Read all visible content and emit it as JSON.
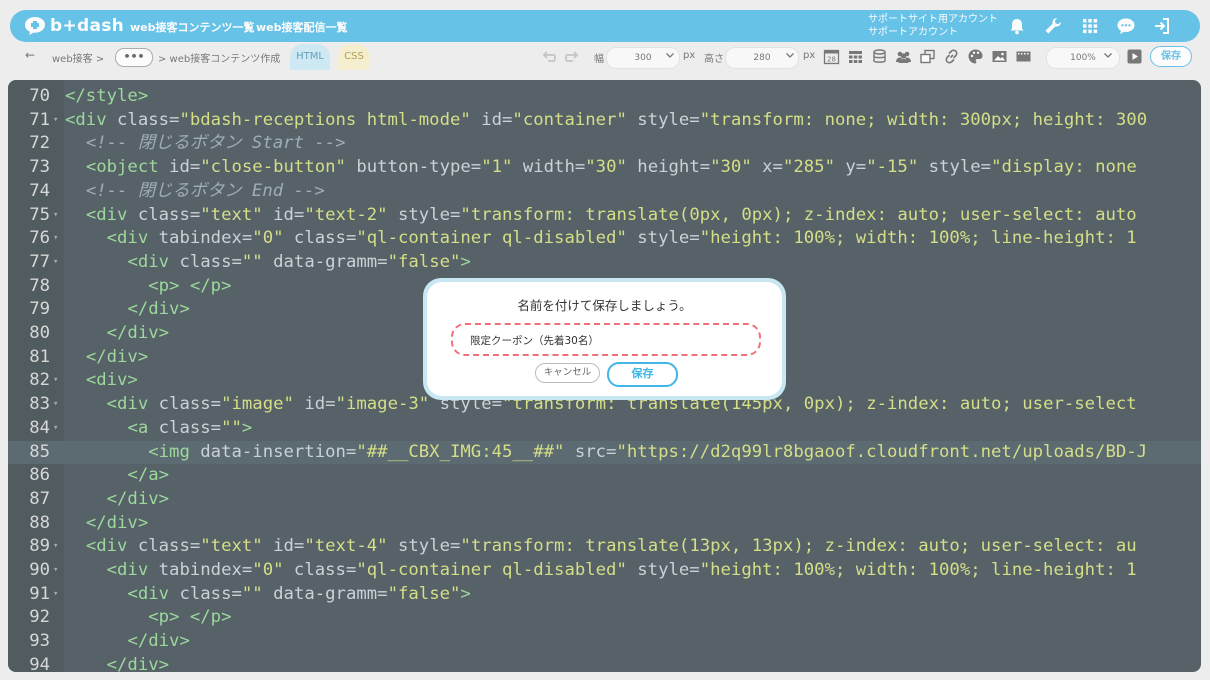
{
  "app": {
    "brand": "b+dash",
    "nav": [
      "web接客コンテンツ一覧",
      "web接客配信一覧"
    ],
    "account_line1": "サポートサイト用アカウント",
    "account_line2": "サポートアカウント",
    "icons": [
      "bell-icon",
      "wrench-icon",
      "grid-icon",
      "chat-icon",
      "logout-icon"
    ]
  },
  "toolbar": {
    "back": "←",
    "crumb1": "web接客 >",
    "more": "•••",
    "crumb2": "> web接客コンテンツ作成",
    "tab_html": "HTML",
    "tab_css": "CSS",
    "width_label": "幅",
    "width_value": "300",
    "width_unit": "px",
    "height_label": "高さ",
    "height_value": "280",
    "height_unit": "px",
    "zoom": "100%",
    "save": "保存"
  },
  "editor": {
    "highlight_line": "85",
    "lines": [
      {
        "n": "70",
        "fold": "",
        "code": [
          [
            "</style>",
            "tag"
          ]
        ]
      },
      {
        "n": "71",
        "fold": "▾",
        "code": [
          [
            "<div ",
            "tag"
          ],
          [
            "class=",
            "attr"
          ],
          [
            "\"bdash-receptions html-mode\"",
            "str"
          ],
          [
            " id=",
            "attr"
          ],
          [
            "\"container\"",
            "str"
          ],
          [
            " style=",
            "attr"
          ],
          [
            "\"transform: none; width: 300px; height: 300",
            "str"
          ]
        ]
      },
      {
        "n": "72",
        "fold": "",
        "code": [
          [
            "  ",
            "attr"
          ],
          [
            "<!-- 閉じるボタン Start -->",
            "cmt"
          ]
        ]
      },
      {
        "n": "73",
        "fold": "",
        "code": [
          [
            "  ",
            "attr"
          ],
          [
            "<object ",
            "tag"
          ],
          [
            "id=",
            "attr"
          ],
          [
            "\"close-button\"",
            "str"
          ],
          [
            " button-type=",
            "attr"
          ],
          [
            "\"1\"",
            "str"
          ],
          [
            " width=",
            "attr"
          ],
          [
            "\"30\"",
            "str"
          ],
          [
            " height=",
            "attr"
          ],
          [
            "\"30\"",
            "str"
          ],
          [
            " x=",
            "attr"
          ],
          [
            "\"285\"",
            "str"
          ],
          [
            " y=",
            "attr"
          ],
          [
            "\"-15\"",
            "str"
          ],
          [
            " style=",
            "attr"
          ],
          [
            "\"display: none",
            "str"
          ]
        ]
      },
      {
        "n": "74",
        "fold": "",
        "code": [
          [
            "  ",
            "attr"
          ],
          [
            "<!-- 閉じるボタン End -->",
            "cmt"
          ]
        ]
      },
      {
        "n": "75",
        "fold": "▾",
        "code": [
          [
            "  ",
            "attr"
          ],
          [
            "<div ",
            "tag"
          ],
          [
            "class=",
            "attr"
          ],
          [
            "\"text\"",
            "str"
          ],
          [
            " id=",
            "attr"
          ],
          [
            "\"text-2\"",
            "str"
          ],
          [
            " style=",
            "attr"
          ],
          [
            "\"transform: translate(0px, 0px); z-index: auto; user-select: auto",
            "str"
          ]
        ]
      },
      {
        "n": "76",
        "fold": "▾",
        "code": [
          [
            "    ",
            "attr"
          ],
          [
            "<div ",
            "tag"
          ],
          [
            "tabindex=",
            "attr"
          ],
          [
            "\"0\"",
            "str"
          ],
          [
            " class=",
            "attr"
          ],
          [
            "\"ql-container ql-disabled\"",
            "str"
          ],
          [
            " style=",
            "attr"
          ],
          [
            "\"height: 100%; width: 100%; line-height: 1",
            "str"
          ]
        ]
      },
      {
        "n": "77",
        "fold": "▾",
        "code": [
          [
            "      ",
            "attr"
          ],
          [
            "<div ",
            "tag"
          ],
          [
            "class=",
            "attr"
          ],
          [
            "\"\"",
            "str"
          ],
          [
            " data-gramm=",
            "attr"
          ],
          [
            "\"false\"",
            "str"
          ],
          [
            ">",
            "tag"
          ]
        ]
      },
      {
        "n": "78",
        "fold": "",
        "code": [
          [
            "        ",
            "attr"
          ],
          [
            "<p> </p>",
            "tag"
          ]
        ]
      },
      {
        "n": "79",
        "fold": "",
        "code": [
          [
            "      ",
            "attr"
          ],
          [
            "</div>",
            "tag"
          ]
        ]
      },
      {
        "n": "80",
        "fold": "",
        "code": [
          [
            "    ",
            "attr"
          ],
          [
            "</div>",
            "tag"
          ]
        ]
      },
      {
        "n": "81",
        "fold": "",
        "code": [
          [
            "  ",
            "attr"
          ],
          [
            "</div>",
            "tag"
          ]
        ]
      },
      {
        "n": "82",
        "fold": "▾",
        "code": [
          [
            "  ",
            "attr"
          ],
          [
            "<div>",
            "tag"
          ]
        ]
      },
      {
        "n": "83",
        "fold": "▾",
        "code": [
          [
            "    ",
            "attr"
          ],
          [
            "<div ",
            "tag"
          ],
          [
            "class=",
            "attr"
          ],
          [
            "\"image\"",
            "str"
          ],
          [
            " id=",
            "attr"
          ],
          [
            "\"image-3\"",
            "str"
          ],
          [
            " style=",
            "attr"
          ],
          [
            "\"transform: translate(145px, 0px); z-index: auto; user-select",
            "str"
          ]
        ]
      },
      {
        "n": "84",
        "fold": "▾",
        "code": [
          [
            "      ",
            "attr"
          ],
          [
            "<a ",
            "tag"
          ],
          [
            "class=",
            "attr"
          ],
          [
            "\"\"",
            "str"
          ],
          [
            ">",
            "tag"
          ]
        ]
      },
      {
        "n": "85",
        "fold": "",
        "code": [
          [
            "        ",
            "attr"
          ],
          [
            "<img ",
            "tag"
          ],
          [
            "data-insertion=",
            "attr"
          ],
          [
            "\"##__CBX_IMG:45__##\"",
            "str"
          ],
          [
            " src=",
            "attr"
          ],
          [
            "\"https://d2q99lr8bgaoof.cloudfront.net/uploads/BD-J",
            "str"
          ]
        ]
      },
      {
        "n": "86",
        "fold": "",
        "code": [
          [
            "      ",
            "attr"
          ],
          [
            "</a>",
            "tag"
          ]
        ]
      },
      {
        "n": "87",
        "fold": "",
        "code": [
          [
            "    ",
            "attr"
          ],
          [
            "</div>",
            "tag"
          ]
        ]
      },
      {
        "n": "88",
        "fold": "",
        "code": [
          [
            "  ",
            "attr"
          ],
          [
            "</div>",
            "tag"
          ]
        ]
      },
      {
        "n": "89",
        "fold": "▾",
        "code": [
          [
            "  ",
            "attr"
          ],
          [
            "<div ",
            "tag"
          ],
          [
            "class=",
            "attr"
          ],
          [
            "\"text\"",
            "str"
          ],
          [
            " id=",
            "attr"
          ],
          [
            "\"text-4\"",
            "str"
          ],
          [
            " style=",
            "attr"
          ],
          [
            "\"transform: translate(13px, 13px); z-index: auto; user-select: au",
            "str"
          ]
        ]
      },
      {
        "n": "90",
        "fold": "▾",
        "code": [
          [
            "    ",
            "attr"
          ],
          [
            "<div ",
            "tag"
          ],
          [
            "tabindex=",
            "attr"
          ],
          [
            "\"0\"",
            "str"
          ],
          [
            " class=",
            "attr"
          ],
          [
            "\"ql-container ql-disabled\"",
            "str"
          ],
          [
            " style=",
            "attr"
          ],
          [
            "\"height: 100%; width: 100%; line-height: 1",
            "str"
          ]
        ]
      },
      {
        "n": "91",
        "fold": "▾",
        "code": [
          [
            "      ",
            "attr"
          ],
          [
            "<div ",
            "tag"
          ],
          [
            "class=",
            "attr"
          ],
          [
            "\"\"",
            "str"
          ],
          [
            " data-gramm=",
            "attr"
          ],
          [
            "\"false\"",
            "str"
          ],
          [
            ">",
            "tag"
          ]
        ]
      },
      {
        "n": "92",
        "fold": "",
        "code": [
          [
            "        ",
            "attr"
          ],
          [
            "<p> </p>",
            "tag"
          ]
        ]
      },
      {
        "n": "93",
        "fold": "",
        "code": [
          [
            "      ",
            "attr"
          ],
          [
            "</div>",
            "tag"
          ]
        ]
      },
      {
        "n": "94",
        "fold": "",
        "code": [
          [
            "    ",
            "attr"
          ],
          [
            "</div>",
            "tag"
          ]
        ]
      }
    ]
  },
  "dialog": {
    "title": "名前を付けて保存しましょう。",
    "input_value": "限定クーポン（先着30名）",
    "cancel": "キャンセル",
    "save": "保存"
  },
  "colors": {
    "accent": "#40b5e6",
    "editor_bg": "#2b3a42",
    "dialog_border": "#f0707a"
  }
}
